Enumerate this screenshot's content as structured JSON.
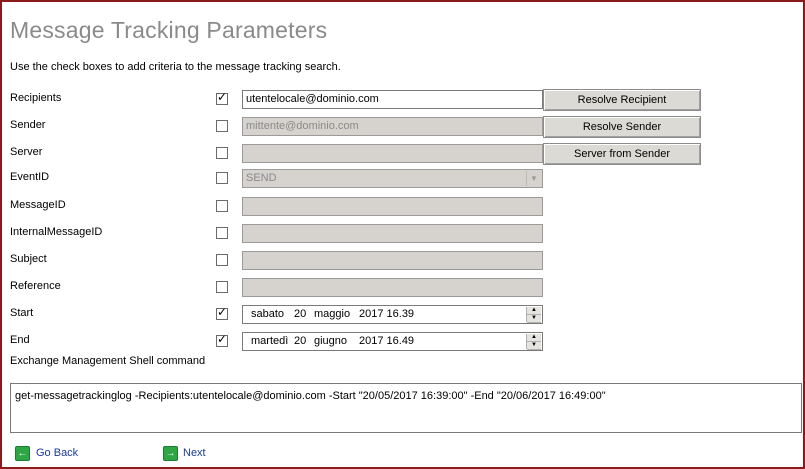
{
  "page": {
    "title": "Message Tracking Parameters",
    "subtitle": "Use the check boxes to add criteria to the message tracking search."
  },
  "fields": [
    {
      "label": "Recipients",
      "checked": true,
      "value": "utentelocale@dominio.com",
      "enabled": true,
      "button": "Resolve Recipient"
    },
    {
      "label": "Sender",
      "checked": false,
      "value": "mittente@dominio.com",
      "enabled": false,
      "button": "Resolve Sender"
    },
    {
      "label": "Server",
      "checked": false,
      "value": "",
      "enabled": false,
      "button": "Server from Sender"
    },
    {
      "label": "EventID",
      "checked": false,
      "value": "SEND",
      "enabled": false,
      "type": "combo"
    },
    {
      "label": "MessageID",
      "checked": false,
      "value": "",
      "enabled": false
    },
    {
      "label": "InternalMessageID",
      "checked": false,
      "value": "",
      "enabled": false
    },
    {
      "label": "Subject",
      "checked": false,
      "value": "",
      "enabled": false
    },
    {
      "label": "Reference",
      "checked": false,
      "value": "",
      "enabled": false
    }
  ],
  "start": {
    "label": "Start",
    "checked": true,
    "weekday": "sabato",
    "day": "20",
    "month": "maggio",
    "year_time": "2017 16.39"
  },
  "end": {
    "label": "End",
    "checked": true,
    "weekday": "martedì",
    "day": "20",
    "month": "giugno",
    "year_time": "2017 16.49"
  },
  "shell": {
    "label": "Exchange Management Shell command",
    "command": "get-messagetrackinglog -Recipients:utentelocale@dominio.com -Start \"20/05/2017 16:39:00\" -End \"20/06/2017 16:49:00\""
  },
  "nav": {
    "back": "Go Back",
    "next": "Next"
  },
  "icons": {
    "check": "check-mark",
    "back": "green-left-arrow-icon",
    "next": "green-right-arrow-icon"
  },
  "colors": {
    "frame": "#8b1a1a",
    "title": "#8a8a8a",
    "disabled_field": "#d6d3ce",
    "link": "#1a3a9a",
    "nav_icon": "#2fa646"
  }
}
